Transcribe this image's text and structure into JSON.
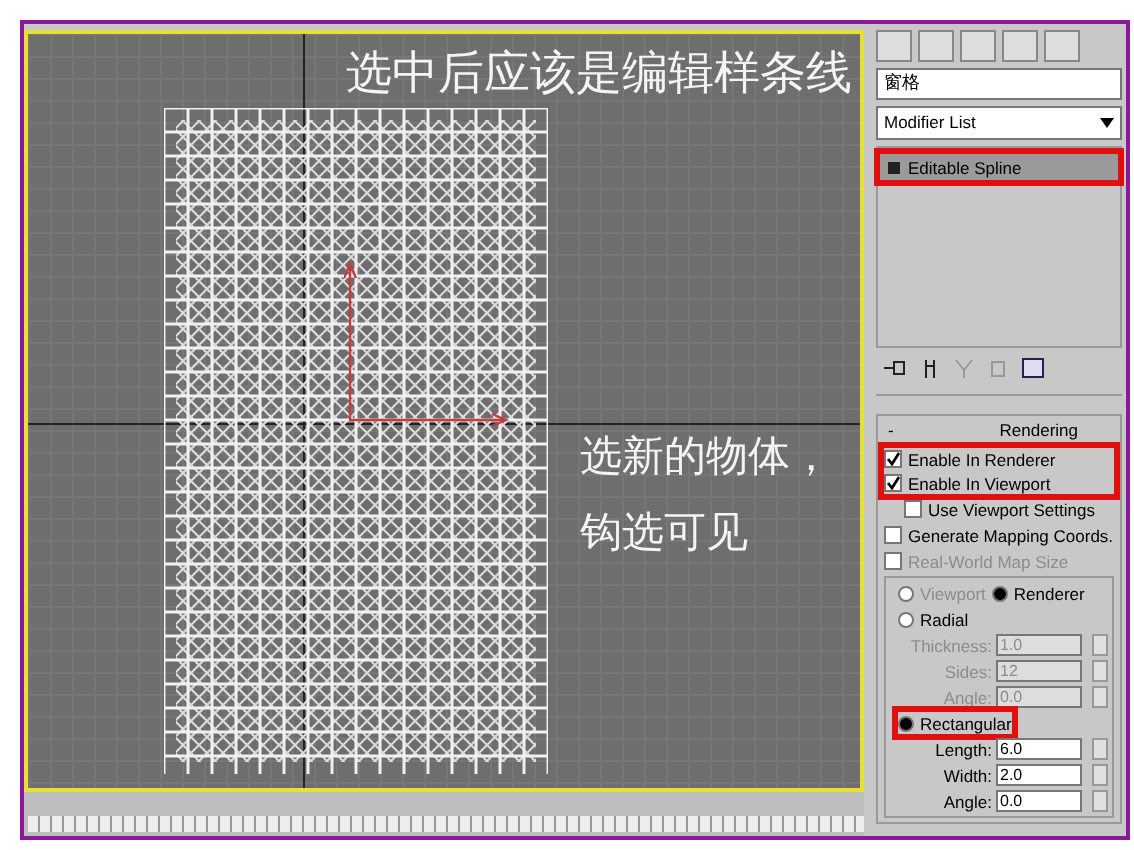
{
  "viewport": {
    "caption_top": "选中后应该是编辑样条线",
    "caption_side": [
      "选新的物体，",
      "钩选可见"
    ]
  },
  "panel": {
    "object_name": "窗格",
    "modifier_list": "Modifier List",
    "stack": [
      {
        "label": "Editable Spline",
        "selected": true,
        "highlighted": true
      }
    ],
    "rollout": {
      "toggle": "-",
      "title": "Rendering"
    },
    "render_checks": {
      "highlighted": true,
      "items": [
        {
          "label": "Enable In Renderer",
          "checked": true,
          "disabled": false
        },
        {
          "label": "Enable In Viewport",
          "checked": true,
          "disabled": false
        }
      ]
    },
    "options": [
      {
        "label": "Use Viewport Settings",
        "checked": false,
        "disabled": false,
        "indent": true
      },
      {
        "label": "Generate Mapping Coords.",
        "checked": false,
        "disabled": false,
        "indent": false
      },
      {
        "label": "Real-World Map Size",
        "checked": false,
        "disabled": true,
        "indent": false
      }
    ],
    "mode": [
      {
        "label": "Viewport",
        "selected": false,
        "disabled": true
      },
      {
        "label": "Renderer",
        "selected": true,
        "disabled": false
      }
    ],
    "shapes": [
      {
        "label": "Radial",
        "selected": false,
        "highlighted": false,
        "params": [
          {
            "label": "Thickness:",
            "value": "1.0"
          },
          {
            "label": "Sides:",
            "value": "12"
          },
          {
            "label": "Angle:",
            "value": "0.0"
          }
        ]
      },
      {
        "label": "Rectangular",
        "selected": true,
        "highlighted": true,
        "params": [
          {
            "label": "Length:",
            "value": "6.0"
          },
          {
            "label": "Width:",
            "value": "2.0"
          },
          {
            "label": "Angle:",
            "value": "0.0"
          }
        ]
      }
    ]
  }
}
